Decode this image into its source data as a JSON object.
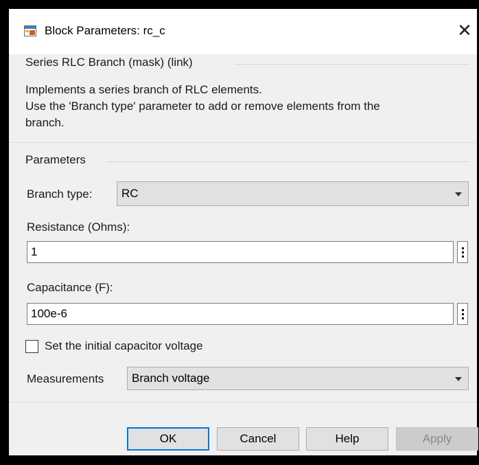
{
  "window": {
    "title": "Block Parameters: rc_c",
    "app_icon": "simulink-block-icon",
    "close_icon": "close-icon",
    "close_glyph": "✕"
  },
  "mask_group": {
    "title": "Series RLC Branch (mask) (link)",
    "description_lines": [
      "Implements a series branch of RLC elements.",
      "Use the 'Branch type' parameter to add or remove elements from the",
      "branch."
    ]
  },
  "parameters": {
    "title": "Parameters",
    "branch_type": {
      "label": "Branch type:",
      "value": "RC"
    },
    "resistance": {
      "label": "Resistance (Ohms):",
      "value": "1"
    },
    "capacitance": {
      "label": "Capacitance (F):",
      "value": "100e-6"
    },
    "initial_voltage_checkbox": {
      "label": "Set the initial capacitor voltage",
      "checked": false
    },
    "measurements": {
      "label": "Measurements",
      "value": "Branch voltage"
    }
  },
  "buttons": {
    "ok": "OK",
    "cancel": "Cancel",
    "help": "Help",
    "apply": "Apply"
  },
  "colors": {
    "dialog_bg": "#f0f0f0",
    "default_button_border": "#0078d7",
    "disabled_text": "#8a8a8a"
  }
}
